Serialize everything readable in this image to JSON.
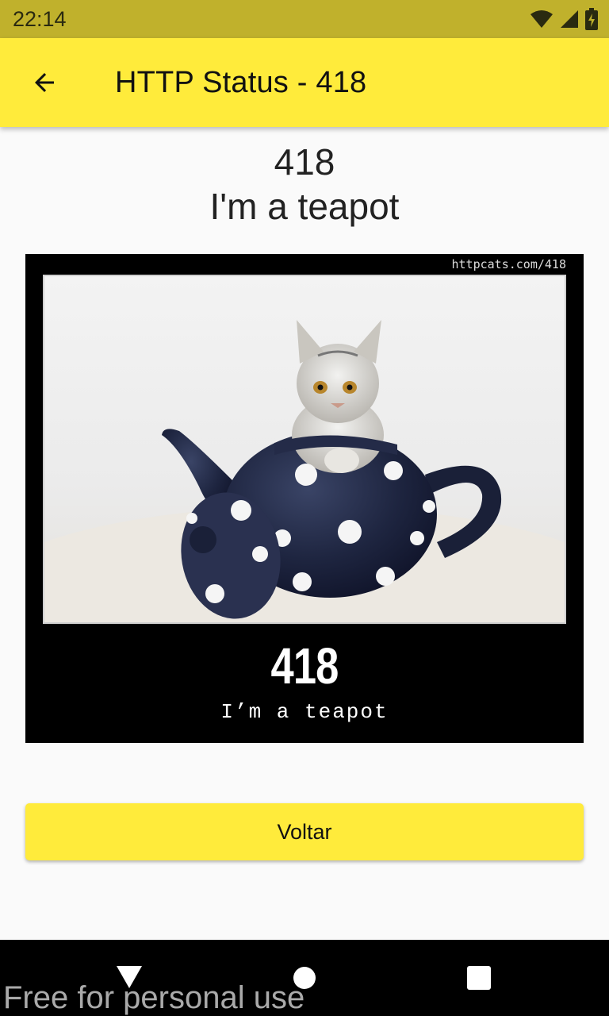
{
  "status_bar": {
    "time": "22:14",
    "icons": [
      "wifi-icon",
      "signal-icon",
      "battery-charging-icon"
    ]
  },
  "app_bar": {
    "back_icon": "arrow-left-icon",
    "title": "HTTP Status - 418"
  },
  "status": {
    "code": "418",
    "description": "I'm a teapot"
  },
  "cat_image": {
    "url_caption": "httpcats.com/418",
    "code": "418",
    "caption": "I’m a teapot"
  },
  "button": {
    "label": "Voltar"
  },
  "nav_bar": {
    "icons": [
      "nav-back-icon",
      "nav-home-icon",
      "nav-recents-icon"
    ]
  },
  "watermark": "Free for personal use",
  "colors": {
    "status_bar": "#c0b12c",
    "app_bar": "#ffeb3b",
    "button": "#ffeb3b",
    "background": "#fafafa",
    "teapot": "#1e2540"
  }
}
